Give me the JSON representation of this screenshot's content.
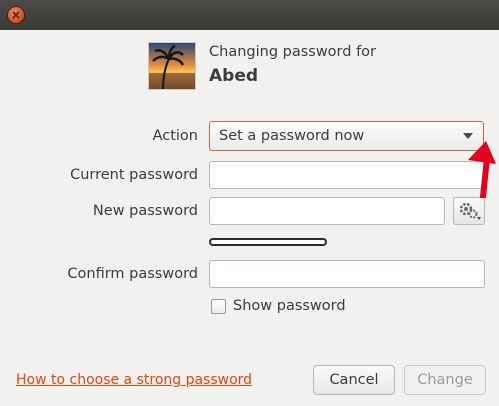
{
  "window": {
    "close_icon": "close-icon"
  },
  "header": {
    "heading": "Changing password for",
    "username": "Abed",
    "avatar_icon": "avatar-image"
  },
  "form": {
    "action_label": "Action",
    "action_value": "Set a password now",
    "current_password_label": "Current password",
    "current_password_value": "",
    "new_password_label": "New password",
    "new_password_value": "",
    "generate_icon": "generate-password-icon",
    "strength_level": 0,
    "confirm_password_label": "Confirm password",
    "confirm_password_value": "",
    "show_password_label": "Show password",
    "show_password_checked": false
  },
  "footer": {
    "help_link": "How to choose a strong password",
    "cancel_label": "Cancel",
    "change_label": "Change"
  },
  "annotation": {
    "color": "#e3001b"
  },
  "colors": {
    "accent": "#dd4814",
    "titlebar": "#3b3a36"
  }
}
